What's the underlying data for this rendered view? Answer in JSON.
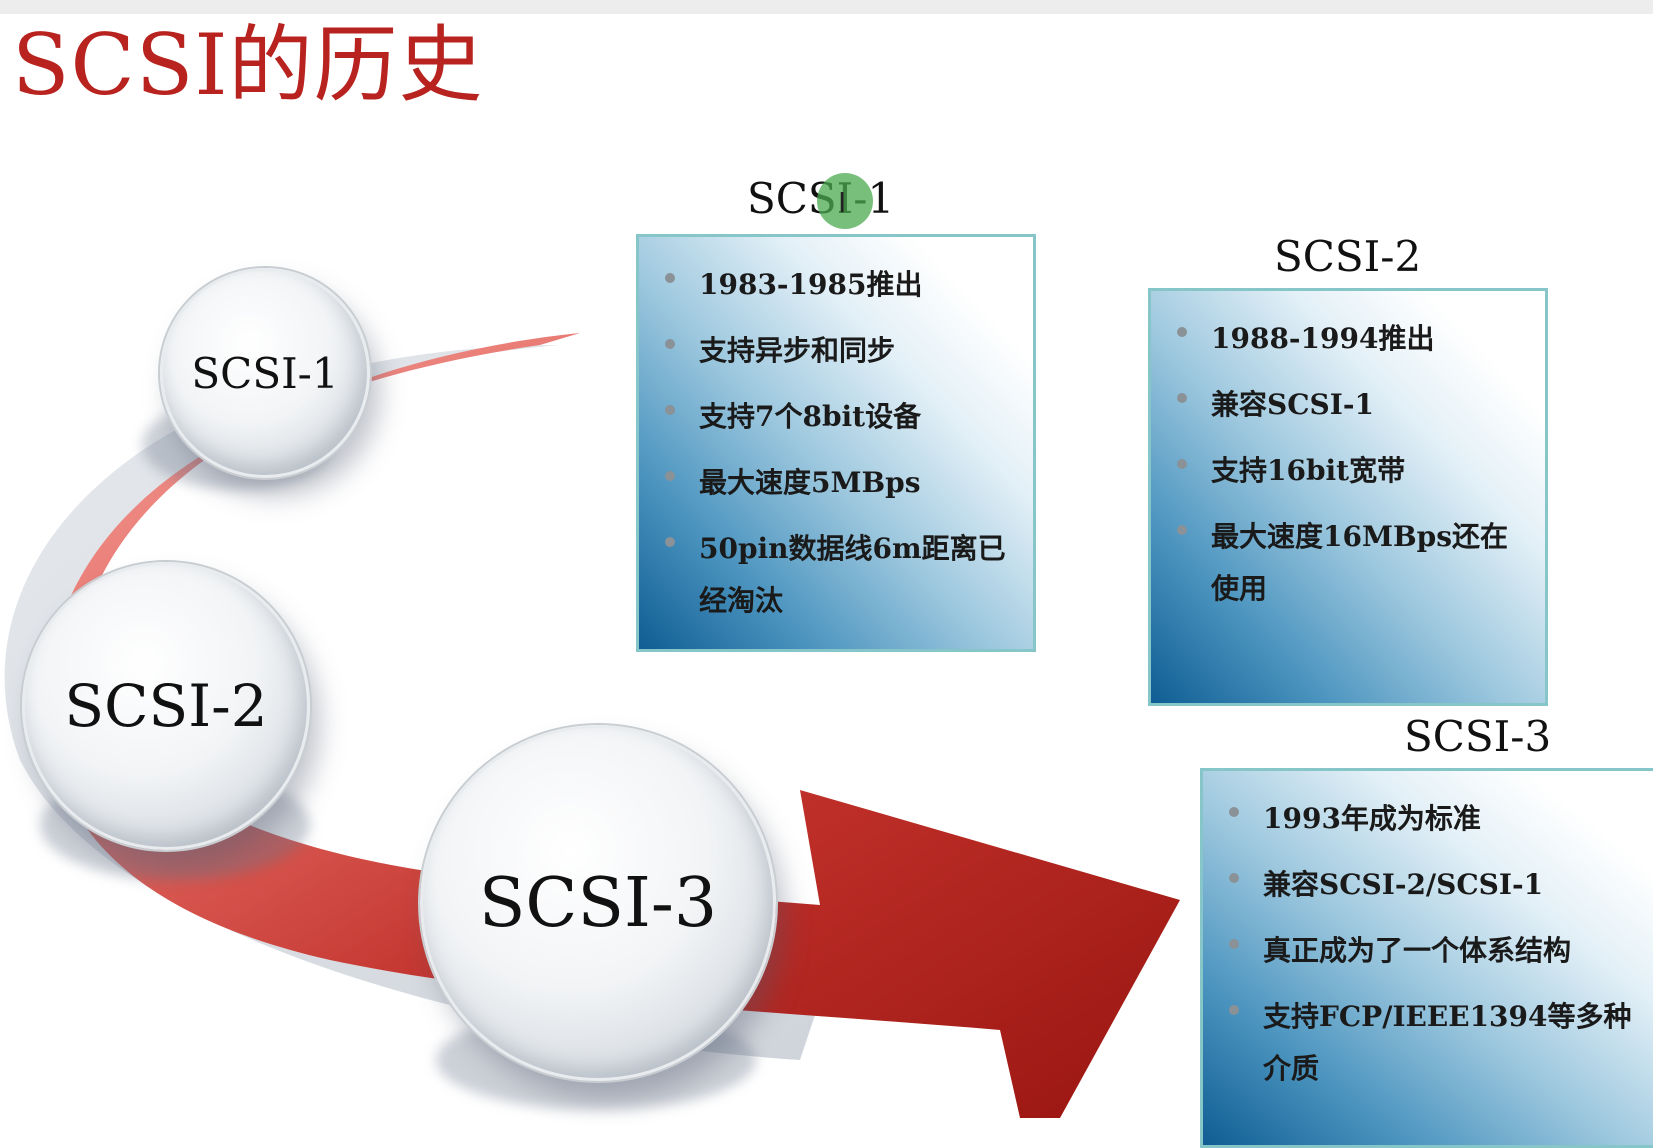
{
  "slide": {
    "title": "SCSI的历史"
  },
  "circles": [
    {
      "label": "SCSI-1"
    },
    {
      "label": "SCSI-2"
    },
    {
      "label": "SCSI-3"
    }
  ],
  "boxes": [
    {
      "title": "SCSI-1",
      "items": [
        "1983-1985推出",
        "支持异步和同步",
        "支持7个8bit设备",
        "最大速度5MBps",
        "50pin数据线6m距离已经淘汰"
      ]
    },
    {
      "title": "SCSI-2",
      "items": [
        "1988-1994推出",
        "兼容SCSI-1",
        "支持16bit宽带",
        "最大速度16MBps还在使用"
      ]
    },
    {
      "title": "SCSI-3",
      "items": [
        "1993年成为标准",
        "兼容SCSI-2/SCSI-1",
        "真正成为了一个体系结构",
        "支持FCP/IEEE1394等多种介质"
      ]
    }
  ],
  "colors": {
    "title": "#b8231f",
    "arrow_light": "#f08a84",
    "arrow_dark": "#b3211b",
    "box_border": "#86c6c9",
    "box_gradient_dark": "#0f5d93"
  },
  "icons": {
    "cursor": "text-cursor-icon"
  }
}
